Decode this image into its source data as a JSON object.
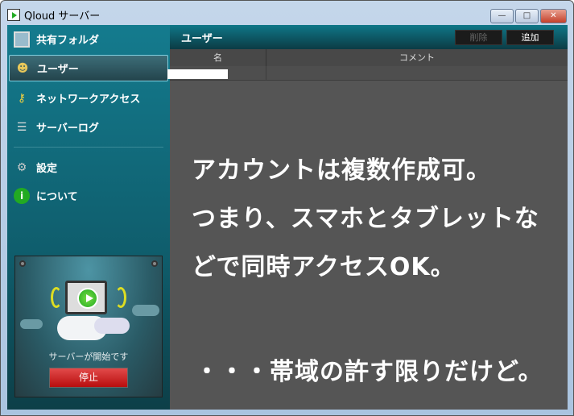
{
  "window": {
    "title": "Qloud サーバー",
    "minimize": "—",
    "maximize": "□",
    "close": "✕"
  },
  "sidebar": {
    "items": [
      {
        "label": "共有フォルダ",
        "icon": "folder-monitor-icon"
      },
      {
        "label": "ユーザー",
        "icon": "user-icon"
      },
      {
        "label": "ネットワークアクセス",
        "icon": "key-icon"
      },
      {
        "label": "サーバーログ",
        "icon": "log-list-icon"
      },
      {
        "label": "設定",
        "icon": "gear-icon"
      },
      {
        "label": "について",
        "icon": "info-icon"
      }
    ],
    "status_text": "サーバーが開始です",
    "stop_label": "停止"
  },
  "main": {
    "title": "ユーザー",
    "delete_label": "削除",
    "add_label": "追加",
    "columns": [
      "名",
      "コメント"
    ]
  },
  "overlay": [
    "アカウントは複数作成可。",
    "つまり、スマホとタブレットな",
    "どで同時アクセスOK。",
    "・・・帯域の許す限りだけど。"
  ]
}
